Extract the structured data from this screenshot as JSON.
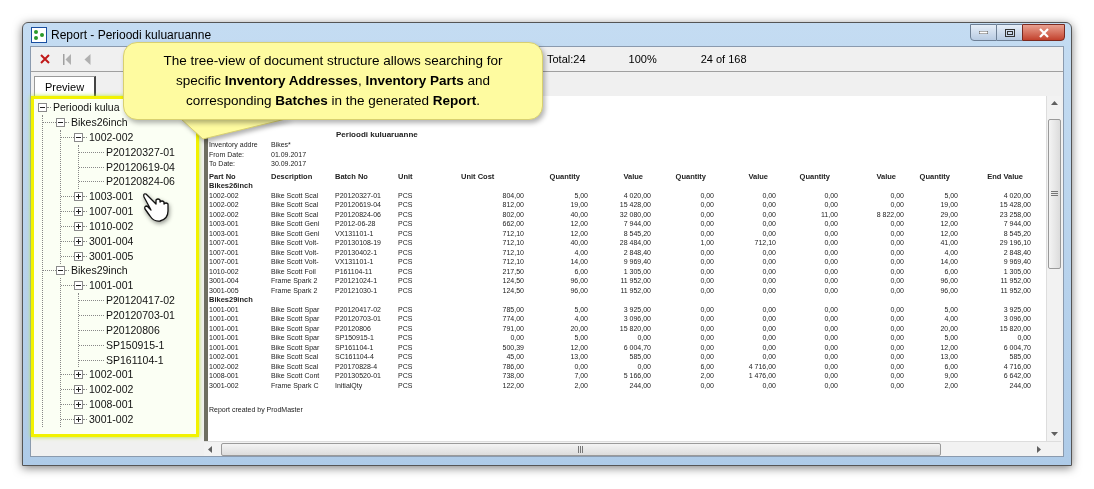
{
  "window": {
    "title": "Report - Perioodi kuluaruanne"
  },
  "toolbar": {
    "total": "Total:24",
    "zoom": "100%",
    "page": "24 of 168"
  },
  "tabs": [
    {
      "label": "Preview",
      "selected": true
    }
  ],
  "tree": [
    {
      "label": "Perioodi kulua",
      "expanded": true,
      "children": [
        {
          "label": "Bikes26inch",
          "expanded": true,
          "children": [
            {
              "label": "1002-002",
              "expanded": true,
              "children": [
                {
                  "label": "P20120327-01"
                },
                {
                  "label": "P20120619-04"
                },
                {
                  "label": "P20120824-06"
                }
              ]
            },
            {
              "label": "1003-001",
              "expanded": false
            },
            {
              "label": "1007-001",
              "expanded": false
            },
            {
              "label": "1010-002",
              "expanded": false
            },
            {
              "label": "3001-004",
              "expanded": false
            },
            {
              "label": "3001-005",
              "expanded": false
            }
          ]
        },
        {
          "label": "Bikes29inch",
          "expanded": true,
          "children": [
            {
              "label": "1001-001",
              "expanded": true,
              "children": [
                {
                  "label": "P20120417-02"
                },
                {
                  "label": "P20120703-01"
                },
                {
                  "label": "P20120806"
                },
                {
                  "label": "SP150915-1"
                },
                {
                  "label": "SP161104-1"
                }
              ]
            },
            {
              "label": "1002-001",
              "expanded": false
            },
            {
              "label": "1002-002",
              "expanded": false
            },
            {
              "label": "1008-001",
              "expanded": false
            },
            {
              "label": "3001-002",
              "expanded": false
            }
          ]
        }
      ]
    }
  ],
  "callout": {
    "text": "The tree-view of document structure allows searching for specific **Inventory Addresses**, **Inventory Parts** and corresponding **Batches** in the generated **Report**."
  },
  "report": {
    "title": "Perioodi kuluaruanne",
    "meta": [
      {
        "label": "Inventory addre",
        "value": "Bikes*"
      },
      {
        "label": "From Date:",
        "value": "01.09.2017"
      },
      {
        "label": "To Date:",
        "value": "30.09.2017"
      }
    ],
    "columns": [
      "Part No",
      "Description",
      "Batch No",
      "Unit",
      "Unit Cost",
      "Quantity",
      "Value",
      "Quantity",
      "Value",
      "Quantity",
      "Value",
      "Quantity",
      "End Value"
    ],
    "groups": [
      {
        "name": "Bikes26inch",
        "rows": [
          [
            "1002-002",
            "Bike Scott Scal",
            "P20120327-01",
            "PCS",
            "804,00",
            "5,00",
            "4 020,00",
            "0,00",
            "0,00",
            "0,00",
            "0,00",
            "5,00",
            "4 020,00"
          ],
          [
            "1002-002",
            "Bike Scott Scal",
            "P20120619-04",
            "PCS",
            "812,00",
            "19,00",
            "15 428,00",
            "0,00",
            "0,00",
            "0,00",
            "0,00",
            "19,00",
            "15 428,00"
          ],
          [
            "1002-002",
            "Bike Scott Scal",
            "P20120824-06",
            "PCS",
            "802,00",
            "40,00",
            "32 080,00",
            "0,00",
            "0,00",
            "11,00",
            "8 822,00",
            "29,00",
            "23 258,00"
          ],
          [
            "1003-001",
            "Bike Scott Geni",
            "P2012-06-28",
            "PCS",
            "662,00",
            "12,00",
            "7 944,00",
            "0,00",
            "0,00",
            "0,00",
            "0,00",
            "12,00",
            "7 944,00"
          ],
          [
            "1003-001",
            "Bike Scott Geni",
            "VX131101-1",
            "PCS",
            "712,10",
            "12,00",
            "8 545,20",
            "0,00",
            "0,00",
            "0,00",
            "0,00",
            "12,00",
            "8 545,20"
          ],
          [
            "1007-001",
            "Bike Scott Volt-",
            "P20130108-19",
            "PCS",
            "712,10",
            "40,00",
            "28 484,00",
            "1,00",
            "712,10",
            "0,00",
            "0,00",
            "41,00",
            "29 196,10"
          ],
          [
            "1007-001",
            "Bike Scott Volt-",
            "P20130402-1",
            "PCS",
            "712,10",
            "4,00",
            "2 848,40",
            "0,00",
            "0,00",
            "0,00",
            "0,00",
            "4,00",
            "2 848,40"
          ],
          [
            "1007-001",
            "Bike Scott Volt-",
            "VX131101-1",
            "PCS",
            "712,10",
            "14,00",
            "9 969,40",
            "0,00",
            "0,00",
            "0,00",
            "0,00",
            "14,00",
            "9 969,40"
          ],
          [
            "1010-002",
            "Bike Scott Foil",
            "P161104-11",
            "PCS",
            "217,50",
            "6,00",
            "1 305,00",
            "0,00",
            "0,00",
            "0,00",
            "0,00",
            "6,00",
            "1 305,00"
          ],
          [
            "3001-004",
            "Frame Spark 2",
            "P20121024-1",
            "PCS",
            "124,50",
            "96,00",
            "11 952,00",
            "0,00",
            "0,00",
            "0,00",
            "0,00",
            "96,00",
            "11 952,00"
          ],
          [
            "3001-005",
            "Frame Spark 2",
            "P20121030-1",
            "PCS",
            "124,50",
            "96,00",
            "11 952,00",
            "0,00",
            "0,00",
            "0,00",
            "0,00",
            "96,00",
            "11 952,00"
          ]
        ]
      },
      {
        "name": "Bikes29inch",
        "rows": [
          [
            "1001-001",
            "Bike Scott Spar",
            "P20120417-02",
            "PCS",
            "785,00",
            "5,00",
            "3 925,00",
            "0,00",
            "0,00",
            "0,00",
            "0,00",
            "5,00",
            "3 925,00"
          ],
          [
            "1001-001",
            "Bike Scott Spar",
            "P20120703-01",
            "PCS",
            "774,00",
            "4,00",
            "3 096,00",
            "0,00",
            "0,00",
            "0,00",
            "0,00",
            "4,00",
            "3 096,00"
          ],
          [
            "1001-001",
            "Bike Scott Spar",
            "P20120806",
            "PCS",
            "791,00",
            "20,00",
            "15 820,00",
            "0,00",
            "0,00",
            "0,00",
            "0,00",
            "20,00",
            "15 820,00"
          ],
          [
            "1001-001",
            "Bike Scott Spar",
            "SP150915-1",
            "PCS",
            "0,00",
            "5,00",
            "0,00",
            "0,00",
            "0,00",
            "0,00",
            "0,00",
            "5,00",
            "0,00"
          ],
          [
            "1001-001",
            "Bike Scott Spar",
            "SP161104-1",
            "PCS",
            "500,39",
            "12,00",
            "6 004,70",
            "0,00",
            "0,00",
            "0,00",
            "0,00",
            "12,00",
            "6 004,70"
          ],
          [
            "1002-001",
            "Bike Scott Scal",
            "SC161104-4",
            "PCS",
            "45,00",
            "13,00",
            "585,00",
            "0,00",
            "0,00",
            "0,00",
            "0,00",
            "13,00",
            "585,00"
          ],
          [
            "1002-002",
            "Bike Scott Scal",
            "P20170828-4",
            "PCS",
            "786,00",
            "0,00",
            "0,00",
            "6,00",
            "4 716,00",
            "0,00",
            "0,00",
            "6,00",
            "4 716,00"
          ],
          [
            "1008-001",
            "Bike Scott Cont",
            "P20130520-01",
            "PCS",
            "738,00",
            "7,00",
            "5 166,00",
            "2,00",
            "1 476,00",
            "0,00",
            "0,00",
            "9,00",
            "6 642,00"
          ],
          [
            "3001-002",
            "Frame Spark C",
            "InitialQty",
            "PCS",
            "122,00",
            "2,00",
            "244,00",
            "0,00",
            "0,00",
            "0,00",
            "0,00",
            "2,00",
            "244,00"
          ]
        ]
      }
    ],
    "footer": "Report created by ProdMaster"
  }
}
